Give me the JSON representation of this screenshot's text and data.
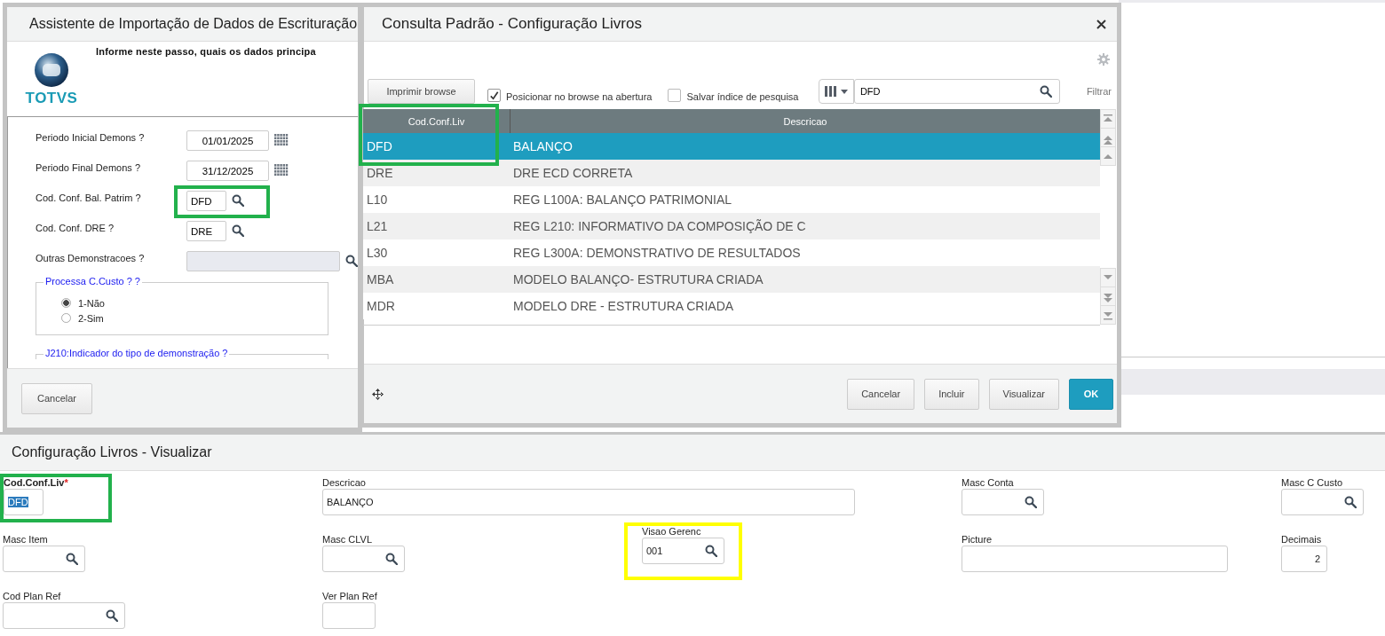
{
  "wizard": {
    "title": "Assistente de Importação de Dados de Escrituração",
    "instruction": "Informe neste passo, quais os dados principa",
    "logo_text": "TOTVS",
    "fields": [
      {
        "label": "Periodo Inicial Demons ?",
        "value": "01/01/2025",
        "kind": "date",
        "disabled": false
      },
      {
        "label": "Periodo Final Demons ?",
        "value": "31/12/2025",
        "kind": "date",
        "disabled": false
      },
      {
        "label": "Cod. Conf. Bal. Patrim ?",
        "value": "DFD",
        "kind": "lookup",
        "disabled": false,
        "color": "#22b14c"
      },
      {
        "label": "Cod. Conf. DRE ?",
        "value": "DRE",
        "kind": "lookup",
        "disabled": false
      },
      {
        "label": "Outras Demonstracoes ?",
        "kind": "wide_lookup",
        "disabled": true
      }
    ],
    "groups": [
      {
        "title": "Processa C.Custo ? ?",
        "options": [
          {
            "label": "1-Não",
            "selected": true
          },
          {
            "label": "2-Sim",
            "selected": false
          }
        ]
      },
      {
        "title": "J210:Indicador do tipo de demonstração ?"
      }
    ],
    "buttons": [
      "Cancelar"
    ]
  },
  "dialog": {
    "title": "Consulta Padrão - Configuração Livros",
    "print_button": "Imprimir browse",
    "options": [
      {
        "label": "Posicionar no browse na abertura",
        "checked": true
      },
      {
        "label": "Salvar índice de pesquisa",
        "checked": false
      }
    ],
    "search": {
      "value": "DFD"
    },
    "filter_link": "Filtrar",
    "table": {
      "columns": [
        {
          "label": "Cod.Conf.Liv",
          "color": "#22b14c"
        },
        {
          "label": "Descricao"
        }
      ],
      "rows": [
        {
          "cells": [
            "DFD",
            "BALANÇO"
          ],
          "selected": true
        },
        {
          "cells": [
            "DRE",
            "DRE ECD CORRETA"
          ],
          "selected": false
        },
        {
          "cells": [
            "L10",
            "REG L100A: BALANÇO PATRIMONIAL"
          ],
          "selected": false
        },
        {
          "cells": [
            "L21",
            "REG L210: INFORMATIVO DA COMPOSIÇÃO DE C"
          ],
          "selected": false
        },
        {
          "cells": [
            "L30",
            "REG L300A: DEMONSTRATIVO DE RESULTADOS"
          ],
          "selected": false
        },
        {
          "cells": [
            "MBA",
            "MODELO BALANÇO- ESTRUTURA CRIADA"
          ],
          "selected": false
        },
        {
          "cells": [
            "MDR",
            "MODELO DRE - ESTRUTURA CRIADA"
          ],
          "selected": false
        }
      ]
    },
    "buttons": [
      {
        "label": "Cancelar",
        "kind": "default"
      },
      {
        "label": "Incluir",
        "kind": "default"
      },
      {
        "label": "Visualizar",
        "kind": "default"
      },
      {
        "label": "OK",
        "kind": "primary"
      }
    ]
  },
  "form": {
    "title": "Configuração Livros - Visualizar",
    "fields": [
      {
        "label": "Cod.Conf.Liv",
        "required_mark": "*",
        "value": "DFD",
        "kind": "code",
        "value_selected": true,
        "color": "#22b14c"
      },
      {
        "label": "Descricao",
        "value": "BALANÇO",
        "kind": "wide"
      },
      {
        "label": "Masc Conta",
        "kind": "lookup"
      },
      {
        "label": "Masc C Custo",
        "kind": "lookup"
      },
      {
        "label": "Masc Item",
        "kind": "lookup"
      },
      {
        "label": "Masc CLVL",
        "kind": "lookup"
      },
      {
        "label": "Visao Gerenc",
        "value": "001",
        "kind": "lookup",
        "color": "#ffff00"
      },
      {
        "label": "Picture",
        "kind": "picture_mask"
      },
      {
        "label": "Decimais",
        "value": "2",
        "kind": "number"
      },
      {
        "label": "Cod Plan Ref",
        "kind": "long_lookup"
      },
      {
        "label": "Ver Plan Ref",
        "kind": "short"
      }
    ]
  }
}
